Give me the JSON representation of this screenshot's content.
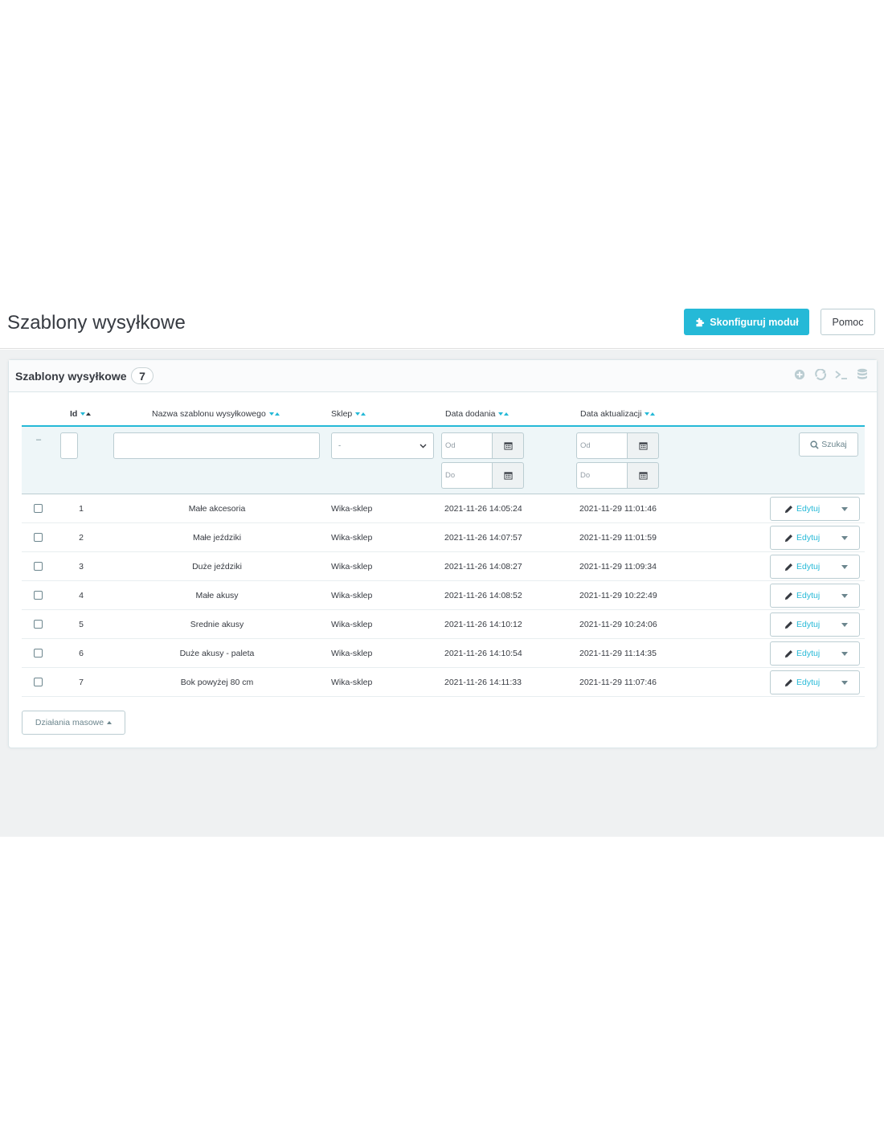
{
  "header": {
    "title": "Szablony wysyłkowe",
    "configure_label": "Skonfiguruj moduł",
    "help_label": "Pomoc",
    "accent": "#25b9d7"
  },
  "panel": {
    "title": "Szablony wysyłkowe",
    "count": "7",
    "tools": [
      "add-icon",
      "refresh-icon",
      "sql-icon",
      "database-icon"
    ]
  },
  "table": {
    "columns": {
      "id": "Id",
      "name": "Nazwa szablonu wysyłkowego",
      "shop": "Sklep",
      "date_add": "Data dodania",
      "date_upd": "Data aktualizacji"
    },
    "filters": {
      "dash": "–",
      "shop_selected": "-",
      "date_from_placeholder": "Od",
      "date_to_placeholder": "Do",
      "search_label": "Szukaj"
    },
    "rows": [
      {
        "id": "1",
        "name": "Małe akcesoria",
        "shop": "Wika-sklep",
        "date_add": "2021-11-26 14:05:24",
        "date_upd": "2021-11-29 11:01:46",
        "action": "Edytuj"
      },
      {
        "id": "2",
        "name": "Małe jeździki",
        "shop": "Wika-sklep",
        "date_add": "2021-11-26 14:07:57",
        "date_upd": "2021-11-29 11:01:59",
        "action": "Edytuj"
      },
      {
        "id": "3",
        "name": "Duże jeździki",
        "shop": "Wika-sklep",
        "date_add": "2021-11-26 14:08:27",
        "date_upd": "2021-11-29 11:09:34",
        "action": "Edytuj"
      },
      {
        "id": "4",
        "name": "Małe akusy",
        "shop": "Wika-sklep",
        "date_add": "2021-11-26 14:08:52",
        "date_upd": "2021-11-29 10:22:49",
        "action": "Edytuj"
      },
      {
        "id": "5",
        "name": "Srednie akusy",
        "shop": "Wika-sklep",
        "date_add": "2021-11-26 14:10:12",
        "date_upd": "2021-11-29 10:24:06",
        "action": "Edytuj"
      },
      {
        "id": "6",
        "name": "Duże akusy - paleta",
        "shop": "Wika-sklep",
        "date_add": "2021-11-26 14:10:54",
        "date_upd": "2021-11-29 11:14:35",
        "action": "Edytuj"
      },
      {
        "id": "7",
        "name": "Bok powyżej 80 cm",
        "shop": "Wika-sklep",
        "date_add": "2021-11-26 14:11:33",
        "date_upd": "2021-11-29 11:07:46",
        "action": "Edytuj"
      }
    ]
  },
  "bulk_actions_label": "Działania masowe"
}
